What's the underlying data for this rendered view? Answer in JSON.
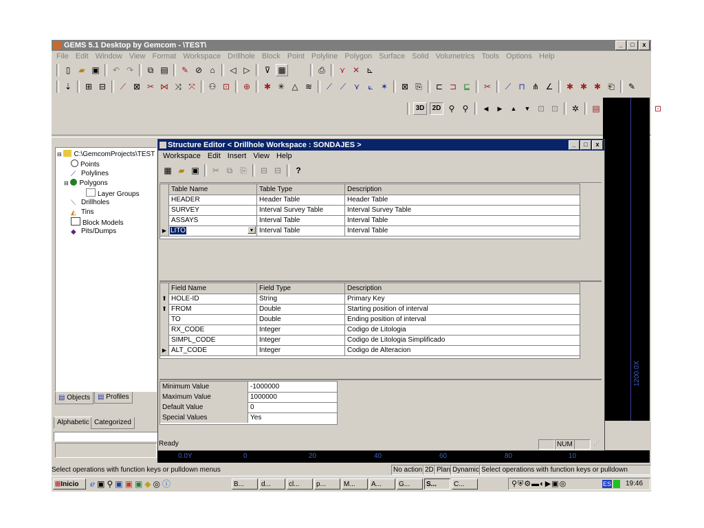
{
  "app": {
    "title": "GEMS 5.1 Desktop by Gemcom - \\TEST\\",
    "menu": [
      "File",
      "Edit",
      "Window",
      "View",
      "Format",
      "Workspace",
      "Drillhole",
      "Block",
      "Point",
      "Polyline",
      "Polygon",
      "Surface",
      "Solid",
      "Volumetrics",
      "Tools",
      "Options",
      "Help"
    ],
    "win_min": "_",
    "win_max": "□",
    "win_close": "x",
    "btn_3d": "3D",
    "btn_2d": "2D",
    "status_text": "Select operations with function keys or pulldown menus",
    "status_panels": [
      "No action",
      "2D",
      "Plan",
      "Dynamic",
      "Select operations with function keys or pulldown menus"
    ]
  },
  "tree": {
    "root": "C:\\GemcomProjects\\TEST",
    "items": [
      "Points",
      "Polylines",
      "Polygons",
      "Layer Groups",
      "Drillholes",
      "Tins",
      "Block Models",
      "Pits/Dumps"
    ],
    "tab_objects": "Objects",
    "tab_profiles": "Profiles",
    "tab_alphabetic": "Alphabetic",
    "tab_categorized": "Categorized"
  },
  "dark": {
    "labels": [
      "0",
      "20",
      "40",
      "60",
      "80",
      "10"
    ],
    "left_label": "0.0Y",
    "vertical_label": "1200.0X"
  },
  "structure_editor": {
    "title": "Structure Editor < Drillhole Workspace : SONDAJES >",
    "menu": [
      "Workspace",
      "Edit",
      "Insert",
      "View",
      "Help"
    ],
    "tables_header": {
      "name": "Table Name",
      "type": "Table Type",
      "desc": "Description"
    },
    "tables": [
      {
        "name": "HEADER",
        "type": "Header Table",
        "desc": "Header Table"
      },
      {
        "name": "SURVEY",
        "type": "Interval Survey Table",
        "desc": "Interval Survey Table"
      },
      {
        "name": "ASSAYS",
        "type": "Interval Table",
        "desc": "Interval Table"
      },
      {
        "name": "LITO",
        "type": "Interval Table",
        "desc": "Interval Table"
      }
    ],
    "fields_header": {
      "name": "Field Name",
      "type": "Field Type",
      "desc": "Description"
    },
    "fields": [
      {
        "name": "HOLE-ID",
        "type": "String",
        "desc": "Primary Key"
      },
      {
        "name": "FROM",
        "type": "Double",
        "desc": "Starting position of interval"
      },
      {
        "name": "TO",
        "type": "Double",
        "desc": "Ending position of interval"
      },
      {
        "name": "RX_CODE",
        "type": "Integer",
        "desc": "Codigo de Litologia"
      },
      {
        "name": "SIMPL_CODE",
        "type": "Integer",
        "desc": "Codigo de Litologia Simplificado"
      },
      {
        "name": "ALT_CODE",
        "type": "Integer",
        "desc": "Codigo de Alteracion"
      }
    ],
    "props": [
      {
        "label": "Minimum Value",
        "value": "-1000000"
      },
      {
        "label": "Maximum Value",
        "value": "1000000"
      },
      {
        "label": "Default Value",
        "value": "0"
      },
      {
        "label": "Special Values",
        "value": "Yes"
      }
    ],
    "status": "Ready",
    "num": "NUM"
  },
  "taskbar": {
    "start": "Inicio",
    "tasks": [
      "B...",
      "d...",
      "cl...",
      "p...",
      "M...",
      "A...",
      "G...",
      "S...",
      "C..."
    ],
    "lang": "ES",
    "clock": "19:46"
  },
  "colors": {
    "face": "#d4d0c8",
    "active_title": "#0a246a",
    "inactive_title": "#7e7e7e"
  }
}
